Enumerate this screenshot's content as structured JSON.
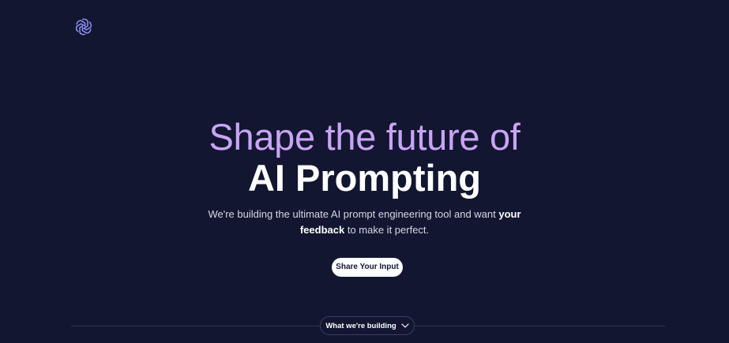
{
  "brand": {
    "logo_icon": "openai-knot-icon",
    "logo_color": "#8c90f2"
  },
  "hero": {
    "headline_line1": "Shape the future of",
    "headline_line2": "AI Prompting",
    "headline_accent_color": "#c9a4f5",
    "subtitle_part1": "We're building the ultimate AI prompt engineering tool and want ",
    "subtitle_bold1": "your",
    "subtitle_bold2": "feedback",
    "subtitle_part2": " to make it perfect."
  },
  "cta": {
    "label": "Share Your Input"
  },
  "section_toggle": {
    "label": "What we're building",
    "icon": "chevron-down-icon"
  },
  "colors": {
    "background": "#121630",
    "divider": "#2f3450"
  }
}
